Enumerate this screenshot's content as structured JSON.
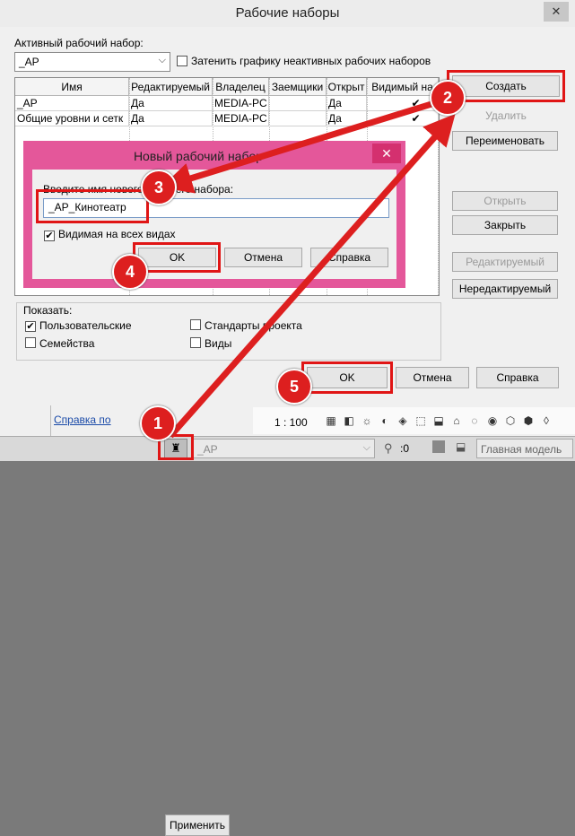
{
  "dialog": {
    "title": "Рабочие наборы",
    "close_glyph": "✕",
    "active_label": "Активный рабочий набор:",
    "active_value": "_АР",
    "shade_checkbox_label": "Затенить графику неактивных рабочих наборов",
    "table": {
      "columns": [
        "Имя",
        "Редактируемый",
        "Владелец",
        "Заемщики",
        "Открыт",
        "Видимый на"
      ],
      "rows": [
        [
          "_АР",
          "Да",
          "MEDIA-PC",
          "",
          "Да",
          "✔"
        ],
        [
          "Общие уровни и сетк",
          "Да",
          "MEDIA-PC",
          "",
          "Да",
          "✔"
        ]
      ]
    },
    "buttons": {
      "create": "Создать",
      "delete": "Удалить",
      "rename": "Переименовать",
      "open": "Открыть",
      "close": "Закрыть",
      "editable": "Редактируемый",
      "non_editable": "Нередактируемый",
      "ok": "OK",
      "cancel": "Отмена",
      "help": "Справка"
    },
    "show_group": {
      "title": "Показать:",
      "user": "Пользовательские",
      "families": "Семейства",
      "project_standards": "Стандарты проекта",
      "views": "Виды"
    }
  },
  "new_dialog": {
    "title": "Новый рабочий набор",
    "close_glyph": "✕",
    "prompt": "Введите имя нового рабочего набора:",
    "name_value": "_АР_Кинотеатр",
    "visible_label": "Видимая на всех видах",
    "ok": "OK",
    "cancel": "Отмена",
    "help": "Справка"
  },
  "statusbar": {
    "help_link": "Справка по",
    "apply": "Применить",
    "scale": "1 : 100"
  },
  "bottombar": {
    "workset": "_АР",
    "counter": ":0",
    "model": "Главная модель"
  },
  "badges": [
    "1",
    "2",
    "3",
    "4",
    "5"
  ],
  "colors": {
    "highlight": "#e01515",
    "dialog_border": "#e4579a",
    "badge": "#dd1f1f"
  }
}
